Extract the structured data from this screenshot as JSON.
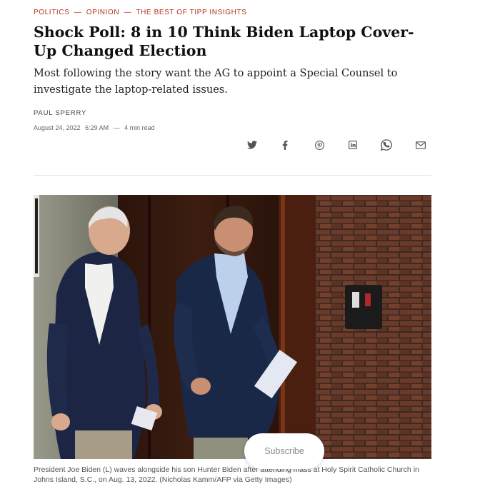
{
  "kicker": {
    "section_1": "POLITICS",
    "section_2": "OPINION",
    "section_3": "THE BEST OF TIPP INSIGHTS",
    "separator": "—"
  },
  "headline": "Shock Poll: 8 in 10 Think Biden Laptop Cover-Up Changed Election",
  "subtitle": "Most following the story want the AG to appoint a Special Counsel to investigate the laptop-related issues.",
  "author": "PAUL SPERRY",
  "meta": {
    "date": "August 24, 2022",
    "time": "6:29 AM",
    "dash": "—",
    "read_time": "4 min read"
  },
  "share_icons": [
    "twitter-icon",
    "facebook-icon",
    "pinterest-icon",
    "linkedin-icon",
    "whatsapp-icon",
    "email-icon"
  ],
  "hero": {
    "alt_subject": "photo-biden-and-son"
  },
  "caption": "President Joe Biden (L) waves alongside his son Hunter Biden after attending mass at Holy Spirit Catholic Church in Johns Island, S.C., on Aug. 13, 2022. (Nicholas Kamm/AFP via Getty Images)",
  "subscribe_label": "Subscribe",
  "colors": {
    "kicker": "#b5341c",
    "icon": "#555555",
    "brick": "#6b3a2a"
  }
}
